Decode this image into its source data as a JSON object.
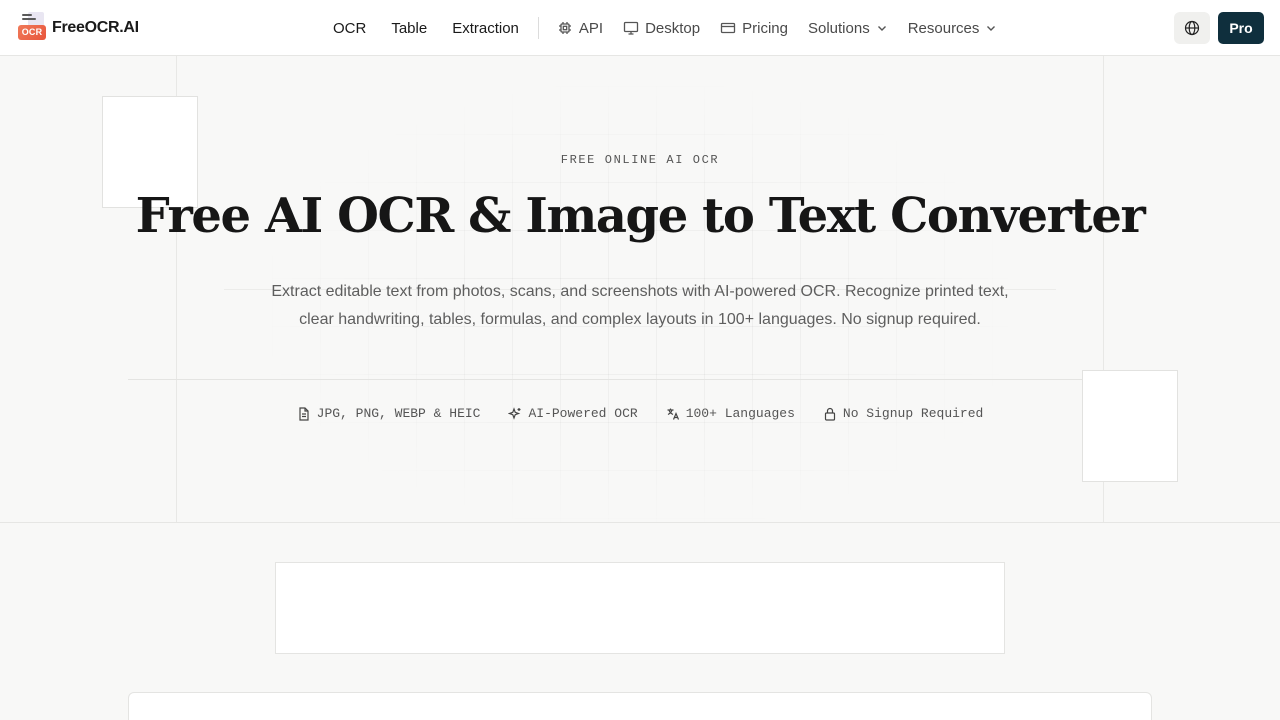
{
  "brand": {
    "name": "FreeOCR.AI",
    "badge": "OCR"
  },
  "nav": {
    "primary": [
      "OCR",
      "Table",
      "Extraction"
    ],
    "api": "API",
    "desktop": "Desktop",
    "pricing": "Pricing",
    "solutions": "Solutions",
    "resources": "Resources"
  },
  "header_actions": {
    "pro_label": "Pro",
    "language_icon": "globe-icon"
  },
  "hero": {
    "eyebrow": "FREE ONLINE AI OCR",
    "title": "Free AI OCR & Image to Text Converter",
    "subtitle_line1": "Extract editable text from photos, scans, and screenshots with AI-powered OCR. Recognize printed text,",
    "subtitle_line2": "clear handwriting, tables, formulas, and complex layouts in 100+ languages. No signup required.",
    "features": [
      {
        "icon": "file-icon",
        "label": "JPG, PNG, WEBP & HEIC"
      },
      {
        "icon": "sparkles-icon",
        "label": "AI-Powered OCR"
      },
      {
        "icon": "translate-icon",
        "label": "100+ Languages"
      },
      {
        "icon": "lock-icon",
        "label": "No Signup Required"
      }
    ]
  },
  "colors": {
    "pro_button": "#0f2f3d",
    "logo_badge": "#e8553c",
    "background": "#f8f8f7"
  }
}
